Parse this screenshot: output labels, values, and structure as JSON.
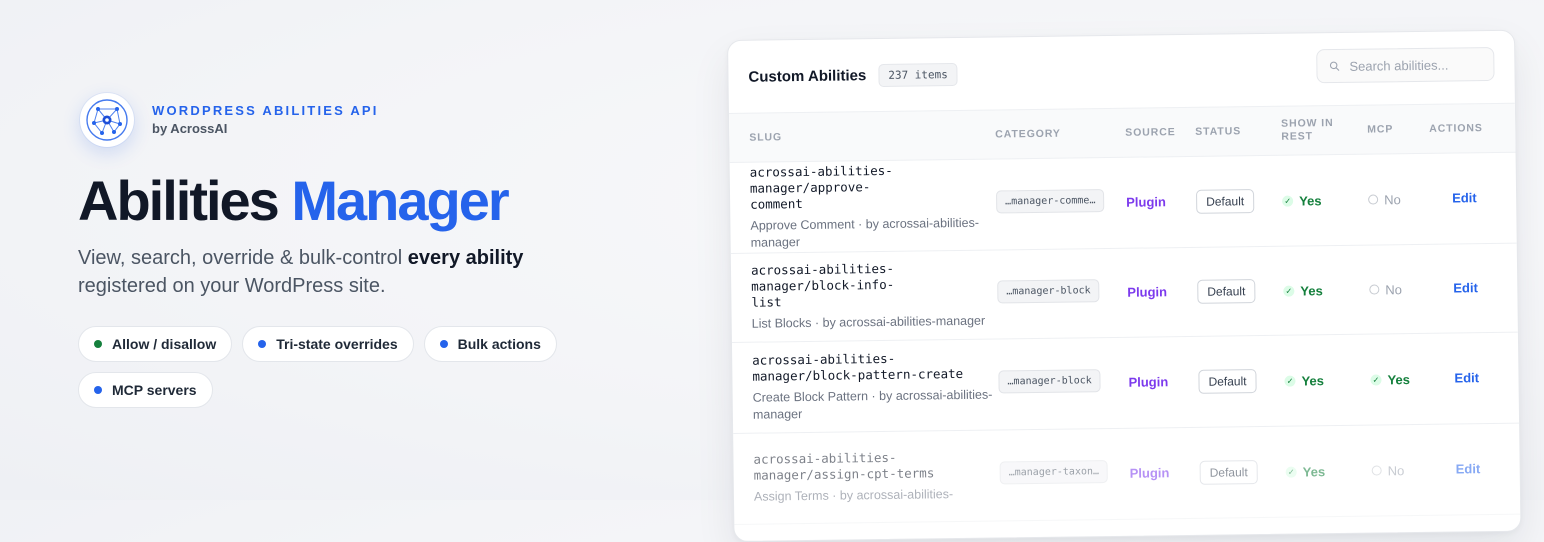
{
  "hero": {
    "eyebrow": "WORDPRESS ABILITIES API",
    "byline": "by AcrossAI",
    "title_part1": "Abilities",
    "title_part2": "Manager",
    "subtitle_plain": "View, search, override & bulk-control ",
    "subtitle_bold": "every ability",
    "subtitle_end": "registered on your WordPress site.",
    "chips": [
      {
        "label": "Allow / disallow",
        "dot_color": "#15803d"
      },
      {
        "label": "Tri-state overrides",
        "dot_color": "#2563eb"
      },
      {
        "label": "Bulk actions",
        "dot_color": "#2563eb"
      },
      {
        "label": "MCP servers",
        "dot_color": "#2563eb"
      }
    ]
  },
  "panel": {
    "title": "Custom Abilities",
    "count_badge": "237 items",
    "search_placeholder": "Search abilities...",
    "columns": {
      "slug": "SLUG",
      "category": "CATEGORY",
      "source": "SOURCE",
      "status": "STATUS",
      "show_in_rest": "SHOW IN REST",
      "mcp": "MCP",
      "actions": "ACTIONS"
    },
    "rows": [
      {
        "slug": "acrossai-abilities-manager/approve-comment",
        "desc": "Approve Comment · by acrossai-abilities-manager",
        "category": "…manager-comme…",
        "source": "Plugin",
        "status": "Default",
        "show_in_rest": "Yes",
        "mcp": "No",
        "action": "Edit"
      },
      {
        "slug": "acrossai-abilities-manager/block-info-list",
        "desc": "List Blocks · by acrossai-abilities-manager",
        "category": "…manager-block",
        "source": "Plugin",
        "status": "Default",
        "show_in_rest": "Yes",
        "mcp": "No",
        "action": "Edit"
      },
      {
        "slug": "acrossai-abilities-manager/block-pattern-create",
        "desc": "Create Block Pattern · by acrossai-abilities-manager",
        "category": "…manager-block",
        "source": "Plugin",
        "status": "Default",
        "show_in_rest": "Yes",
        "mcp": "Yes",
        "action": "Edit"
      },
      {
        "slug": "acrossai-abilities-manager/assign-cpt-terms",
        "desc": "Assign Terms · by acrossai-abilities-",
        "category": "…manager-taxon…",
        "source": "Plugin",
        "status": "Default",
        "show_in_rest": "Yes",
        "mcp": "No",
        "action": "Edit"
      }
    ],
    "colors": {
      "accent": "#2563eb",
      "plugin": "#7c3aed",
      "yes": "#15803d",
      "no": "#9ca3af"
    }
  }
}
